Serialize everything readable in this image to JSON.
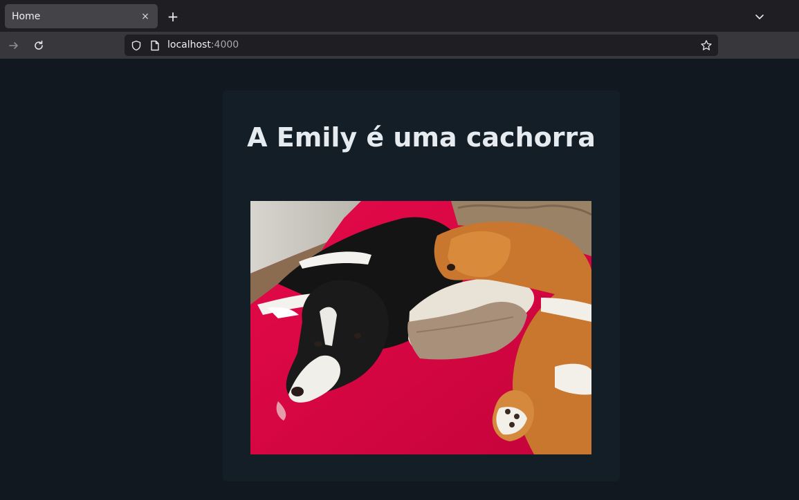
{
  "browser": {
    "tab": {
      "title": "Home",
      "close_glyph": "×"
    },
    "new_tab_glyph": "+",
    "url": {
      "host": "localhost",
      "port": ":4000"
    },
    "icons": [
      "chevron-down-icon",
      "forward-arrow-icon",
      "reload-icon",
      "shield-icon",
      "page-icon",
      "star-icon"
    ]
  },
  "page": {
    "title": "A Emily é uma cachorra",
    "image": {
      "alt": "",
      "colors": {
        "blanket": "#d8073f",
        "wall": "#cfcdc6",
        "floor": "#8a6a4f"
      }
    }
  },
  "colors": {
    "background": "#111820",
    "card": "#141e26",
    "title": "#e6ebef"
  }
}
